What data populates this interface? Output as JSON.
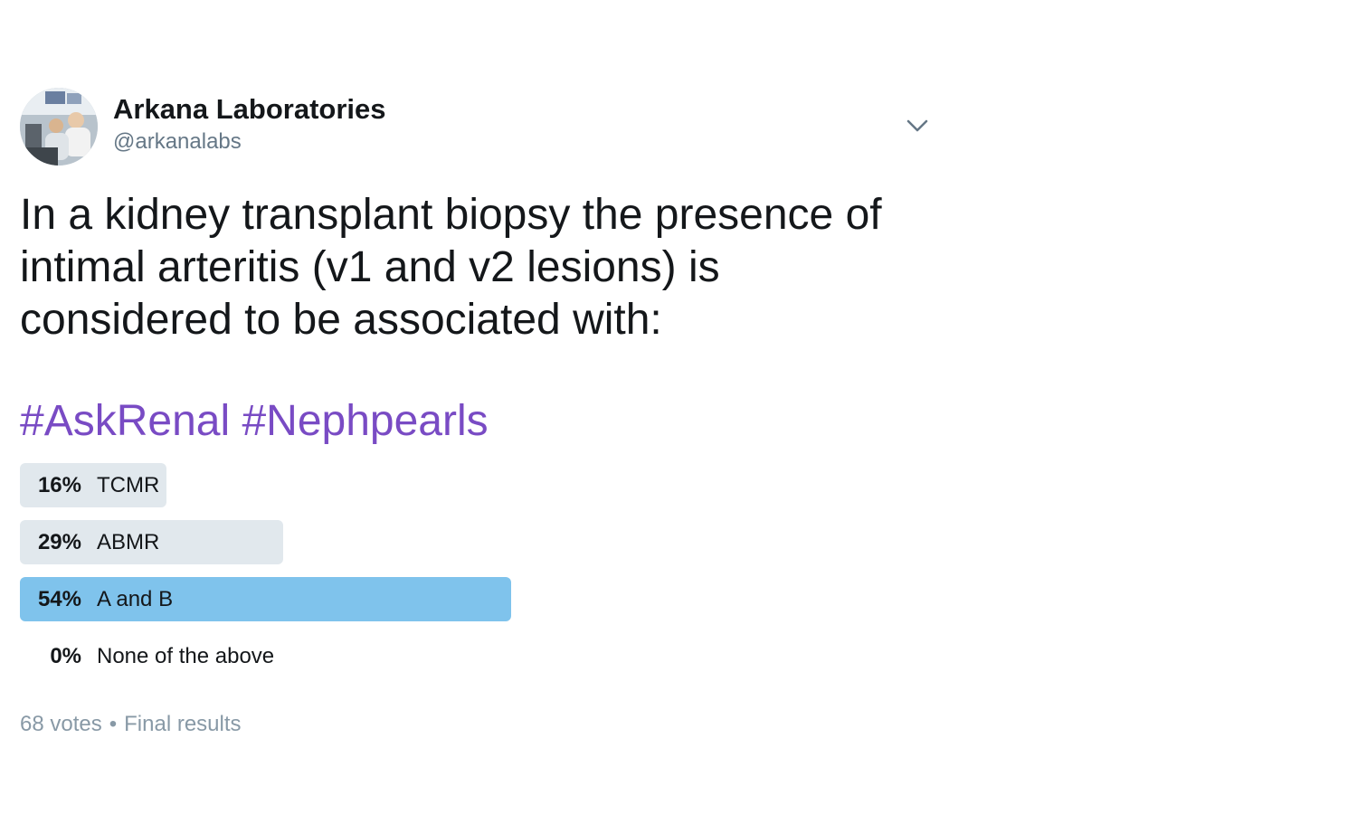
{
  "author": {
    "name": "Arkana Laboratories",
    "handle": "@arkanalabs",
    "avatar_icon": "avatar-photo"
  },
  "tweet": {
    "text": "In a kidney transplant biopsy the presence of intimal arteritis (v1 and v2 lesions) is considered to be associated with:",
    "hashtags": [
      "#AskRenal",
      "#Nephpearls"
    ],
    "menu_icon": "chevron-down-icon"
  },
  "poll": {
    "choices": [
      {
        "percent": "16%",
        "label": "TCMR",
        "fraction": 0.16,
        "winner": false
      },
      {
        "percent": "29%",
        "label": "ABMR",
        "fraction": 0.29,
        "winner": false
      },
      {
        "percent": "54%",
        "label": "A and B",
        "fraction": 0.54,
        "winner": true
      },
      {
        "percent": "0%",
        "label": "None of the above",
        "fraction": 0.0,
        "winner": false
      }
    ],
    "votes": "68 votes",
    "separator": "•",
    "status": "Final results"
  },
  "colors": {
    "hashtag": "#794bc4",
    "bar": "#e1e8ed",
    "winner_bar": "#7fc3ec",
    "meta": "#8899a6"
  }
}
